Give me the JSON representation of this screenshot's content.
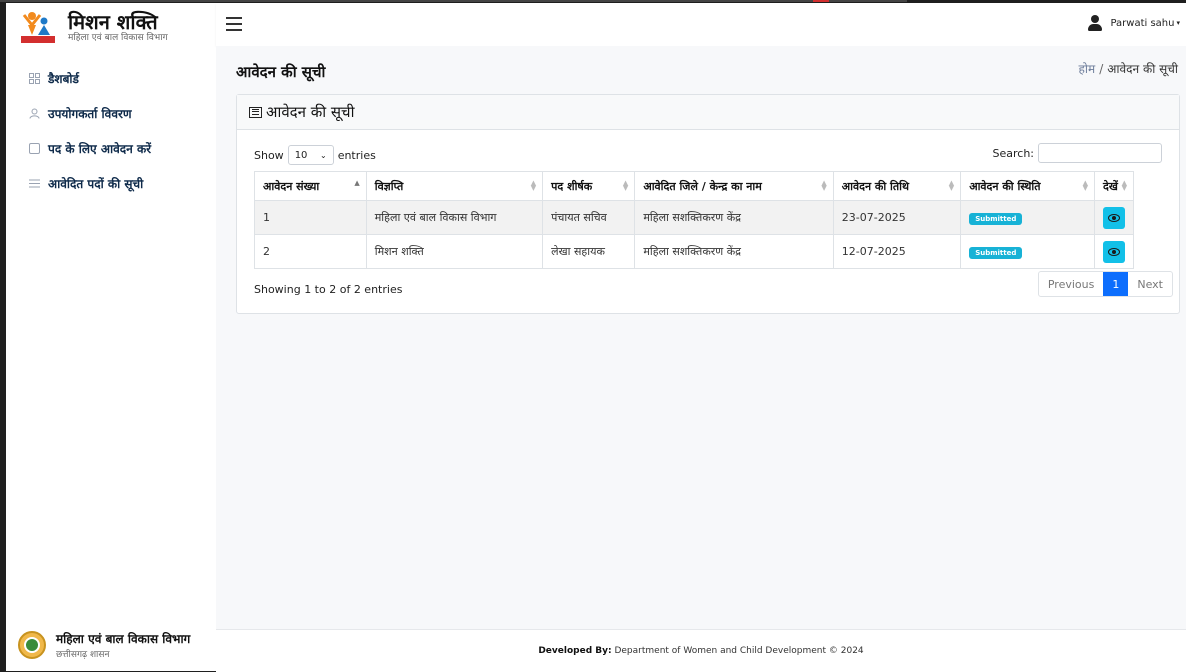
{
  "brand": {
    "title": "मिशन शक्ति",
    "subtitle": "महिला एवं बाल विकास विभाग"
  },
  "sidebar": {
    "items": [
      {
        "label": "डैशबोर्ड",
        "icon": "grid-icon"
      },
      {
        "label": "उपयोगकर्ता विवरण",
        "icon": "user-icon"
      },
      {
        "label": "पद के लिए आवेदन करें",
        "icon": "square-icon"
      },
      {
        "label": "आवेदित पदों की सूची",
        "icon": "list-icon"
      }
    ],
    "footer": {
      "title": "महिला एवं बाल विकास विभाग",
      "subtitle": "छत्तीसगढ़ शासन"
    }
  },
  "header": {
    "user_name": "Parwati sahu"
  },
  "page": {
    "title": "आवेदन की सूची",
    "breadcrumb_home": "होम",
    "breadcrumb_sep": "/",
    "breadcrumb_current": "आवेदन की सूची"
  },
  "card": {
    "title": "आवेदन की सूची"
  },
  "controls": {
    "show_label": "Show",
    "entries_value": "10",
    "entries_label": "entries",
    "search_label": "Search:",
    "search_value": ""
  },
  "table": {
    "columns": [
      "आवेदन संख्या",
      "विज्ञप्ति",
      "पद शीर्षक",
      "आवेदित जिले / केन्द्र का नाम",
      "आवेदन की तिथि",
      "आवेदन की स्थिति",
      "देखें"
    ],
    "rows": [
      {
        "no": "1",
        "notice": "महिला एवं बाल विकास विभाग",
        "post": "पंचायत सचिव",
        "center": "महिला सशक्तिकरण केंद्र",
        "date": "23-07-2025",
        "status": "Submitted"
      },
      {
        "no": "2",
        "notice": "मिशन शक्ति",
        "post": "लेखा सहायक",
        "center": "महिला सशक्तिकरण केंद्र",
        "date": "12-07-2025",
        "status": "Submitted"
      }
    ]
  },
  "pagination": {
    "info": "Showing 1 to 2 of 2 entries",
    "previous": "Previous",
    "current": "1",
    "next": "Next"
  },
  "footer": {
    "developed_by_label": "Developed By:",
    "developed_by_text": "Department of Women and Child Development © 2024"
  },
  "colors": {
    "accent": "#0d6efd",
    "badge": "#17b2d6",
    "view_button": "#12c0e8"
  }
}
